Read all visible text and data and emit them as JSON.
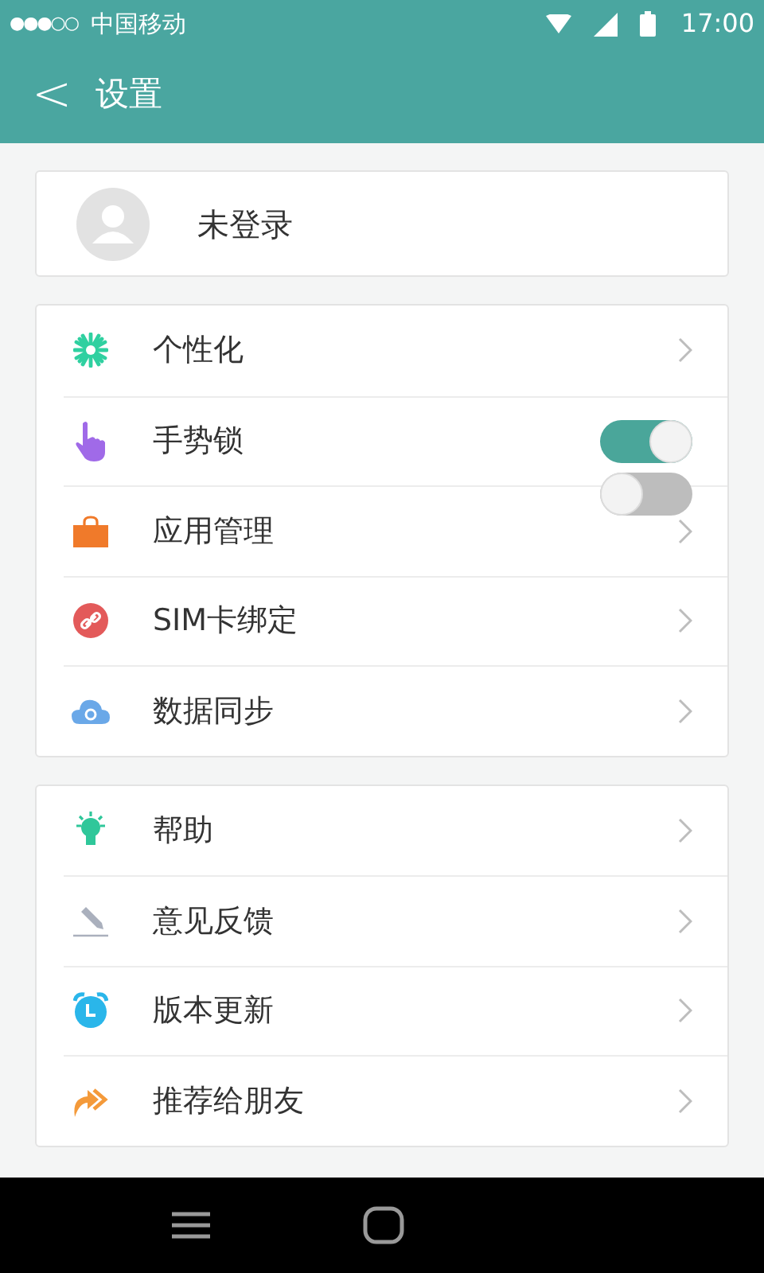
{
  "status_bar": {
    "signal_dots": "●●●○○",
    "carrier": "中国移动",
    "time": "17:00"
  },
  "header": {
    "back": "<",
    "title": "设置"
  },
  "account": {
    "label": "未登录"
  },
  "groups": [
    {
      "items": [
        {
          "label": "个性化",
          "kind": "link"
        },
        {
          "label": "手势锁",
          "kind": "toggle",
          "on": true
        },
        {
          "label": "应用管理",
          "kind": "link",
          "stray_toggle": {
            "on": false
          }
        },
        {
          "label": "SIM卡绑定",
          "kind": "link"
        },
        {
          "label": "数据同步",
          "kind": "link"
        }
      ]
    },
    {
      "items": [
        {
          "label": "帮助",
          "kind": "link"
        },
        {
          "label": "意见反馈",
          "kind": "link"
        },
        {
          "label": "版本更新",
          "kind": "link"
        },
        {
          "label": "推荐给朋友",
          "kind": "link"
        }
      ]
    }
  ]
}
